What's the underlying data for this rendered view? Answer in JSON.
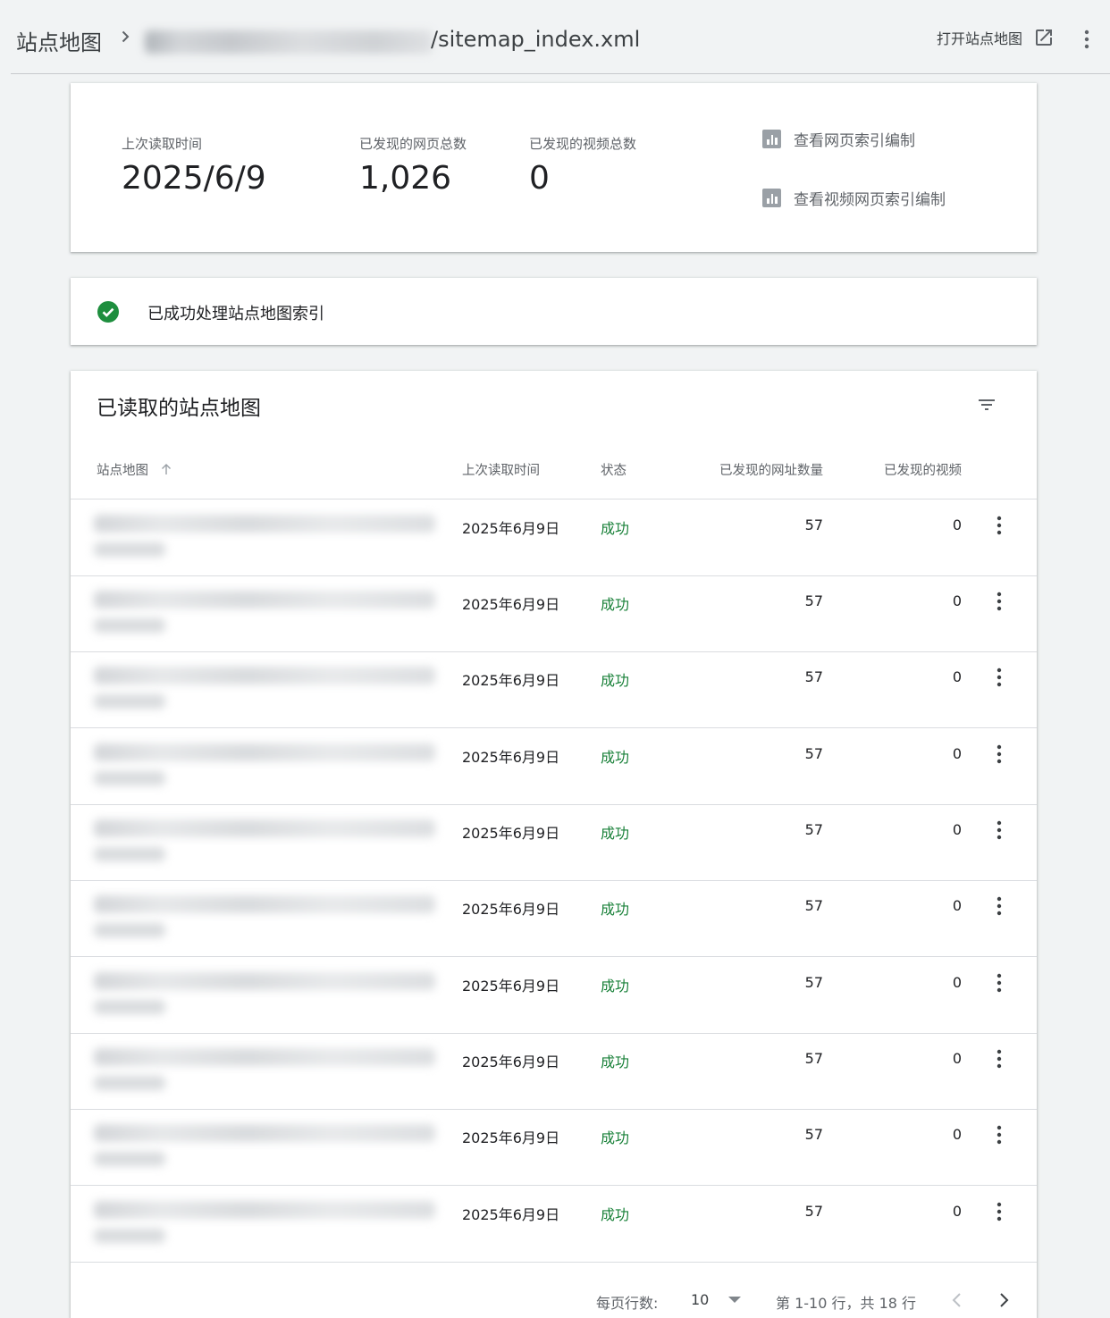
{
  "header": {
    "breadcrumb_root": "站点地图",
    "breadcrumb_path": "/sitemap_index.xml",
    "open_sitemap_label": "打开站点地图"
  },
  "summary": {
    "last_read_label": "上次读取时间",
    "last_read_value": "2025/6/9",
    "pages_label": "已发现的网页总数",
    "pages_value": "1,026",
    "videos_label": "已发现的视频总数",
    "videos_value": "0",
    "link_page_index": "查看网页索引编制",
    "link_video_index": "查看视频网页索引编制"
  },
  "status": {
    "message": "已成功处理站点地图索引"
  },
  "table": {
    "title": "已读取的站点地图",
    "columns": {
      "sitemap": "站点地图",
      "last_read": "上次读取时间",
      "status": "状态",
      "urls": "已发现的网址数量",
      "videos": "已发现的视频"
    },
    "rows": [
      {
        "date": "2025年6月9日",
        "status": "成功",
        "urls": "57",
        "videos": "0"
      },
      {
        "date": "2025年6月9日",
        "status": "成功",
        "urls": "57",
        "videos": "0"
      },
      {
        "date": "2025年6月9日",
        "status": "成功",
        "urls": "57",
        "videos": "0"
      },
      {
        "date": "2025年6月9日",
        "status": "成功",
        "urls": "57",
        "videos": "0"
      },
      {
        "date": "2025年6月9日",
        "status": "成功",
        "urls": "57",
        "videos": "0"
      },
      {
        "date": "2025年6月9日",
        "status": "成功",
        "urls": "57",
        "videos": "0"
      },
      {
        "date": "2025年6月9日",
        "status": "成功",
        "urls": "57",
        "videos": "0"
      },
      {
        "date": "2025年6月9日",
        "status": "成功",
        "urls": "57",
        "videos": "0"
      },
      {
        "date": "2025年6月9日",
        "status": "成功",
        "urls": "57",
        "videos": "0"
      },
      {
        "date": "2025年6月9日",
        "status": "成功",
        "urls": "57",
        "videos": "0"
      }
    ]
  },
  "pagination": {
    "rows_per_page_label": "每页行数:",
    "rows_per_page_value": "10",
    "range_text": "第 1-10 行，共 18 行"
  },
  "colors": {
    "success": "#188038",
    "check_icon": "#1e8e3e",
    "page_bg": "#f1f3f4"
  },
  "icons": {
    "breadcrumb_separator": "chevron-right-icon",
    "open_sitemap": "open-in-new-icon",
    "more": "more-vert-icon",
    "report": "bar-chart-icon",
    "status": "check-circle-icon",
    "filter": "filter-list-icon",
    "sort": "arrow-up-icon",
    "dropdown": "arrow-drop-down-icon",
    "prev": "chevron-left-icon",
    "next": "chevron-right-icon"
  }
}
